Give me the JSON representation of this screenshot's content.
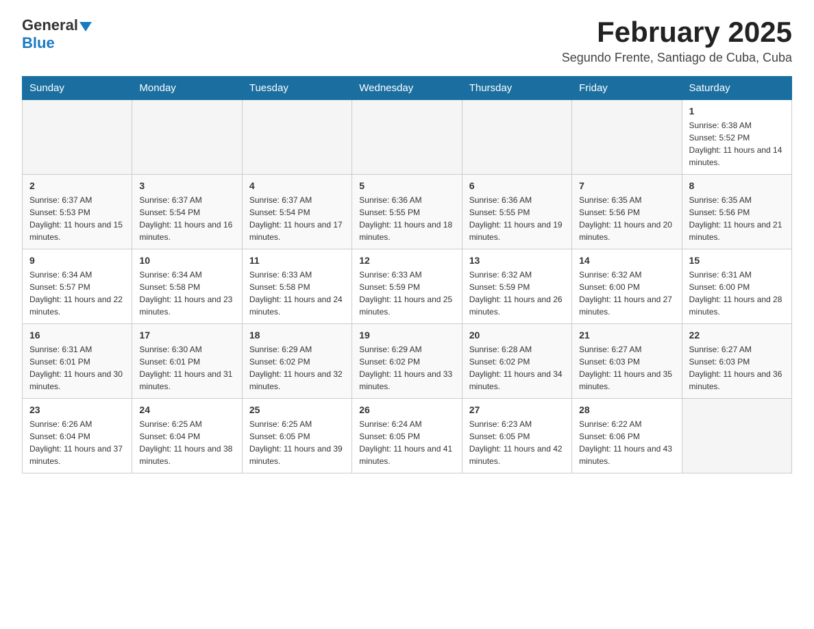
{
  "header": {
    "logo": {
      "general": "General",
      "blue": "Blue"
    },
    "title": "February 2025",
    "subtitle": "Segundo Frente, Santiago de Cuba, Cuba"
  },
  "days_of_week": [
    "Sunday",
    "Monday",
    "Tuesday",
    "Wednesday",
    "Thursday",
    "Friday",
    "Saturday"
  ],
  "weeks": [
    [
      {
        "day": "",
        "info": ""
      },
      {
        "day": "",
        "info": ""
      },
      {
        "day": "",
        "info": ""
      },
      {
        "day": "",
        "info": ""
      },
      {
        "day": "",
        "info": ""
      },
      {
        "day": "",
        "info": ""
      },
      {
        "day": "1",
        "info": "Sunrise: 6:38 AM\nSunset: 5:52 PM\nDaylight: 11 hours and 14 minutes."
      }
    ],
    [
      {
        "day": "2",
        "info": "Sunrise: 6:37 AM\nSunset: 5:53 PM\nDaylight: 11 hours and 15 minutes."
      },
      {
        "day": "3",
        "info": "Sunrise: 6:37 AM\nSunset: 5:54 PM\nDaylight: 11 hours and 16 minutes."
      },
      {
        "day": "4",
        "info": "Sunrise: 6:37 AM\nSunset: 5:54 PM\nDaylight: 11 hours and 17 minutes."
      },
      {
        "day": "5",
        "info": "Sunrise: 6:36 AM\nSunset: 5:55 PM\nDaylight: 11 hours and 18 minutes."
      },
      {
        "day": "6",
        "info": "Sunrise: 6:36 AM\nSunset: 5:55 PM\nDaylight: 11 hours and 19 minutes."
      },
      {
        "day": "7",
        "info": "Sunrise: 6:35 AM\nSunset: 5:56 PM\nDaylight: 11 hours and 20 minutes."
      },
      {
        "day": "8",
        "info": "Sunrise: 6:35 AM\nSunset: 5:56 PM\nDaylight: 11 hours and 21 minutes."
      }
    ],
    [
      {
        "day": "9",
        "info": "Sunrise: 6:34 AM\nSunset: 5:57 PM\nDaylight: 11 hours and 22 minutes."
      },
      {
        "day": "10",
        "info": "Sunrise: 6:34 AM\nSunset: 5:58 PM\nDaylight: 11 hours and 23 minutes."
      },
      {
        "day": "11",
        "info": "Sunrise: 6:33 AM\nSunset: 5:58 PM\nDaylight: 11 hours and 24 minutes."
      },
      {
        "day": "12",
        "info": "Sunrise: 6:33 AM\nSunset: 5:59 PM\nDaylight: 11 hours and 25 minutes."
      },
      {
        "day": "13",
        "info": "Sunrise: 6:32 AM\nSunset: 5:59 PM\nDaylight: 11 hours and 26 minutes."
      },
      {
        "day": "14",
        "info": "Sunrise: 6:32 AM\nSunset: 6:00 PM\nDaylight: 11 hours and 27 minutes."
      },
      {
        "day": "15",
        "info": "Sunrise: 6:31 AM\nSunset: 6:00 PM\nDaylight: 11 hours and 28 minutes."
      }
    ],
    [
      {
        "day": "16",
        "info": "Sunrise: 6:31 AM\nSunset: 6:01 PM\nDaylight: 11 hours and 30 minutes."
      },
      {
        "day": "17",
        "info": "Sunrise: 6:30 AM\nSunset: 6:01 PM\nDaylight: 11 hours and 31 minutes."
      },
      {
        "day": "18",
        "info": "Sunrise: 6:29 AM\nSunset: 6:02 PM\nDaylight: 11 hours and 32 minutes."
      },
      {
        "day": "19",
        "info": "Sunrise: 6:29 AM\nSunset: 6:02 PM\nDaylight: 11 hours and 33 minutes."
      },
      {
        "day": "20",
        "info": "Sunrise: 6:28 AM\nSunset: 6:02 PM\nDaylight: 11 hours and 34 minutes."
      },
      {
        "day": "21",
        "info": "Sunrise: 6:27 AM\nSunset: 6:03 PM\nDaylight: 11 hours and 35 minutes."
      },
      {
        "day": "22",
        "info": "Sunrise: 6:27 AM\nSunset: 6:03 PM\nDaylight: 11 hours and 36 minutes."
      }
    ],
    [
      {
        "day": "23",
        "info": "Sunrise: 6:26 AM\nSunset: 6:04 PM\nDaylight: 11 hours and 37 minutes."
      },
      {
        "day": "24",
        "info": "Sunrise: 6:25 AM\nSunset: 6:04 PM\nDaylight: 11 hours and 38 minutes."
      },
      {
        "day": "25",
        "info": "Sunrise: 6:25 AM\nSunset: 6:05 PM\nDaylight: 11 hours and 39 minutes."
      },
      {
        "day": "26",
        "info": "Sunrise: 6:24 AM\nSunset: 6:05 PM\nDaylight: 11 hours and 41 minutes."
      },
      {
        "day": "27",
        "info": "Sunrise: 6:23 AM\nSunset: 6:05 PM\nDaylight: 11 hours and 42 minutes."
      },
      {
        "day": "28",
        "info": "Sunrise: 6:22 AM\nSunset: 6:06 PM\nDaylight: 11 hours and 43 minutes."
      },
      {
        "day": "",
        "info": ""
      }
    ]
  ]
}
